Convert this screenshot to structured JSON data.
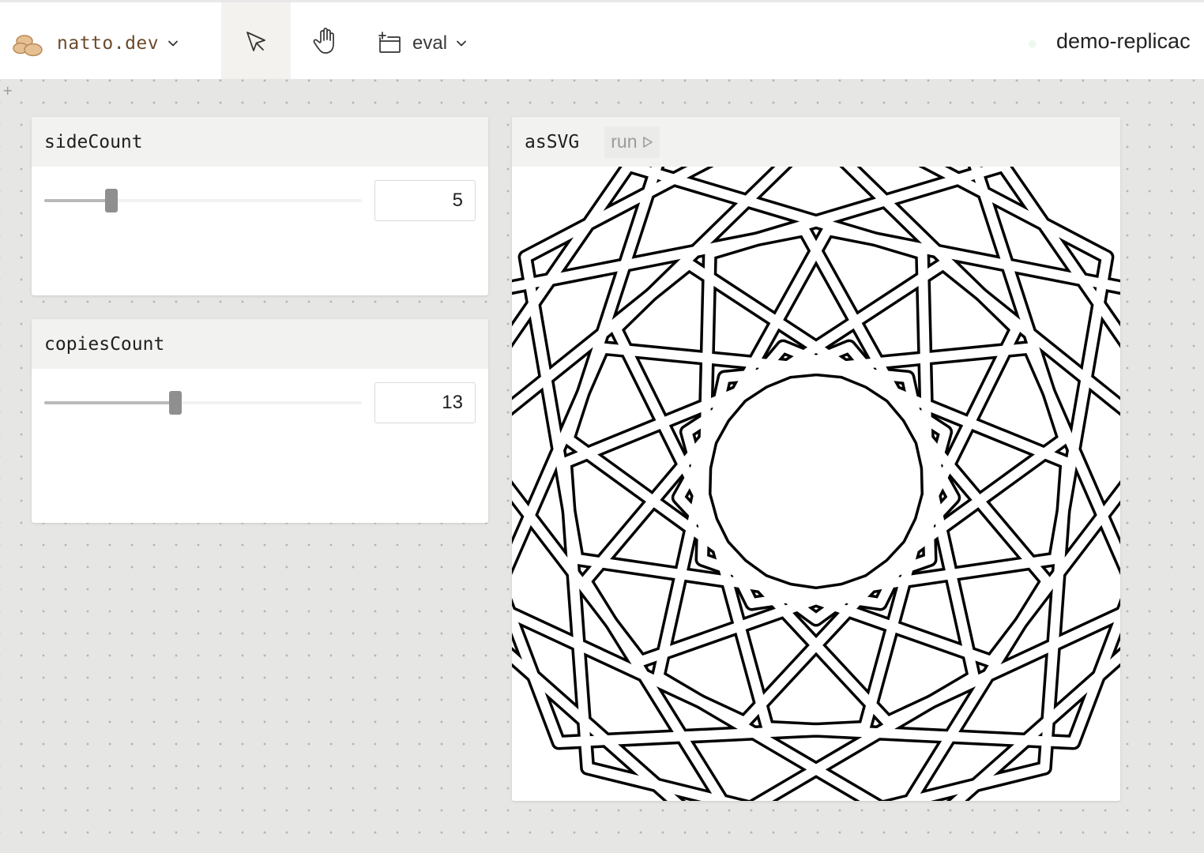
{
  "app": {
    "name": "natto.dev",
    "logo_icon": "potato-logo-icon"
  },
  "toolbar": {
    "tools": [
      {
        "name": "select-tool",
        "icon": "cursor-arrow-icon",
        "active": true
      },
      {
        "name": "hand-tool",
        "icon": "hand-icon",
        "active": false
      }
    ],
    "eval_label": "eval",
    "replica_name": "demo-replicac"
  },
  "panels": {
    "side_count": {
      "title": "sideCount",
      "value": "5",
      "slider": {
        "min": 1,
        "max": 20,
        "value": 5
      }
    },
    "copies_count": {
      "title": "copiesCount",
      "value": "13",
      "slider": {
        "min": 1,
        "max": 30,
        "value": 13
      }
    },
    "as_svg": {
      "title": "asSVG",
      "run_label": "run"
    }
  },
  "colors": {
    "brand_text": "#6b4a2b",
    "accent_logo": "#e3b98a",
    "canvas_bg": "#e6e6e4"
  }
}
